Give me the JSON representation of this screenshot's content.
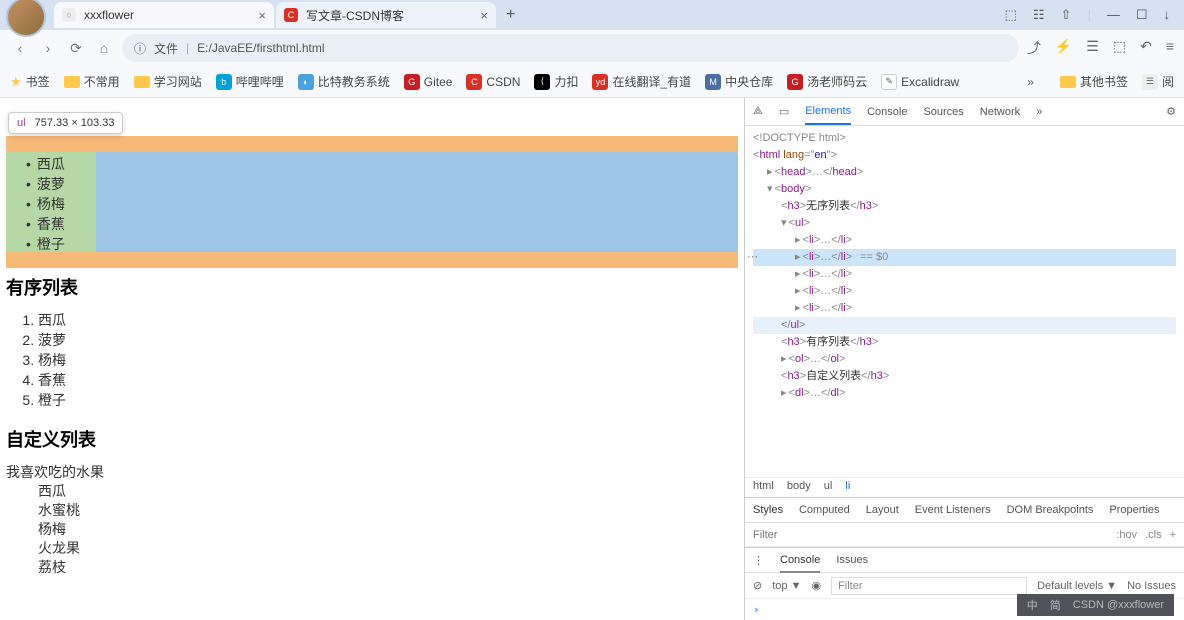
{
  "tabs": [
    {
      "title": "xxxflower",
      "favicon_bg": "#fff",
      "favicon_text": "",
      "active": true
    },
    {
      "title": "写文章-CSDN博客",
      "favicon_bg": "#d93025",
      "favicon_text": "C",
      "active": false
    }
  ],
  "url": {
    "label": "文件",
    "path": "E:/JavaEE/firsthtml.html",
    "info_icon": "ⓘ"
  },
  "bookmarks": [
    {
      "label": "书签",
      "type": "star"
    },
    {
      "label": "不常用",
      "type": "folder"
    },
    {
      "label": "学习网站",
      "type": "folder"
    },
    {
      "label": "哔哩哔哩",
      "type": "icon",
      "bg": "#00a1d6",
      "text": "b"
    },
    {
      "label": "比特教务系统",
      "type": "icon",
      "bg": "#4aa3df",
      "text": "◐"
    },
    {
      "label": "Gitee",
      "type": "icon",
      "bg": "#c71d23",
      "text": "G"
    },
    {
      "label": "CSDN",
      "type": "icon",
      "bg": "#d93025",
      "text": "C"
    },
    {
      "label": "力扣",
      "type": "icon",
      "bg": "#000",
      "text": "⟨"
    },
    {
      "label": "在线翻译_有道",
      "type": "icon",
      "bg": "#d93025",
      "text": "yd"
    },
    {
      "label": "中央仓库",
      "type": "icon",
      "bg": "#4a6fa5",
      "text": "M"
    },
    {
      "label": "汤老师码云",
      "type": "icon",
      "bg": "#c71d23",
      "text": "G"
    },
    {
      "label": "Excalidraw",
      "type": "icon",
      "bg": "#fff",
      "text": "✎"
    }
  ],
  "bookmarks_more": "»",
  "bookmarks_right": [
    {
      "label": "其他书签",
      "type": "folder"
    },
    {
      "label": "阅",
      "type": "icon"
    }
  ],
  "tooltip": {
    "tag": "ul",
    "dim": "757.33 × 103.33"
  },
  "page": {
    "ul_items": [
      "西瓜",
      "菠萝",
      "杨梅",
      "香蕉",
      "橙子"
    ],
    "h3_ordered": "有序列表",
    "ol_items": [
      "西瓜",
      "菠萝",
      "杨梅",
      "香蕉",
      "橙子"
    ],
    "h3_custom": "自定义列表",
    "dl_term": "我喜欢吃的水果",
    "dl_defs": [
      "西瓜",
      "水蜜桃",
      "杨梅",
      "火龙果",
      "荔枝"
    ]
  },
  "devtools": {
    "tabs": [
      "Elements",
      "Console",
      "Sources",
      "Network"
    ],
    "tabs_more": "»",
    "doctype": "<!DOCTYPE html>",
    "html_open": {
      "tag": "html",
      "attr": "lang",
      "val": "en"
    },
    "head": "head",
    "body": "body",
    "h3_1": "无序列表",
    "ul": "ul",
    "li": "li",
    "sel_mark": "== $0",
    "h3_2": "有序列表",
    "ol": "ol",
    "h3_3": "自定义列表",
    "dl": "dl",
    "crumbs": [
      "html",
      "body",
      "ul",
      "li"
    ],
    "styles_tabs": [
      "Styles",
      "Computed",
      "Layout",
      "Event Listeners",
      "DOM Breakpoints",
      "Properties"
    ],
    "filter_placeholder": "Filter",
    "hov": ":hov",
    "cls": ".cls",
    "console_tabs": [
      "Console",
      "Issues"
    ],
    "console_ctrl": {
      "top": "top ▼",
      "filter": "Filter",
      "levels": "Default levels ▼",
      "issues": "No Issues"
    }
  },
  "watermark": {
    "ime": "中",
    "ime2": "简",
    "text": "CSDN @xxxflower"
  }
}
